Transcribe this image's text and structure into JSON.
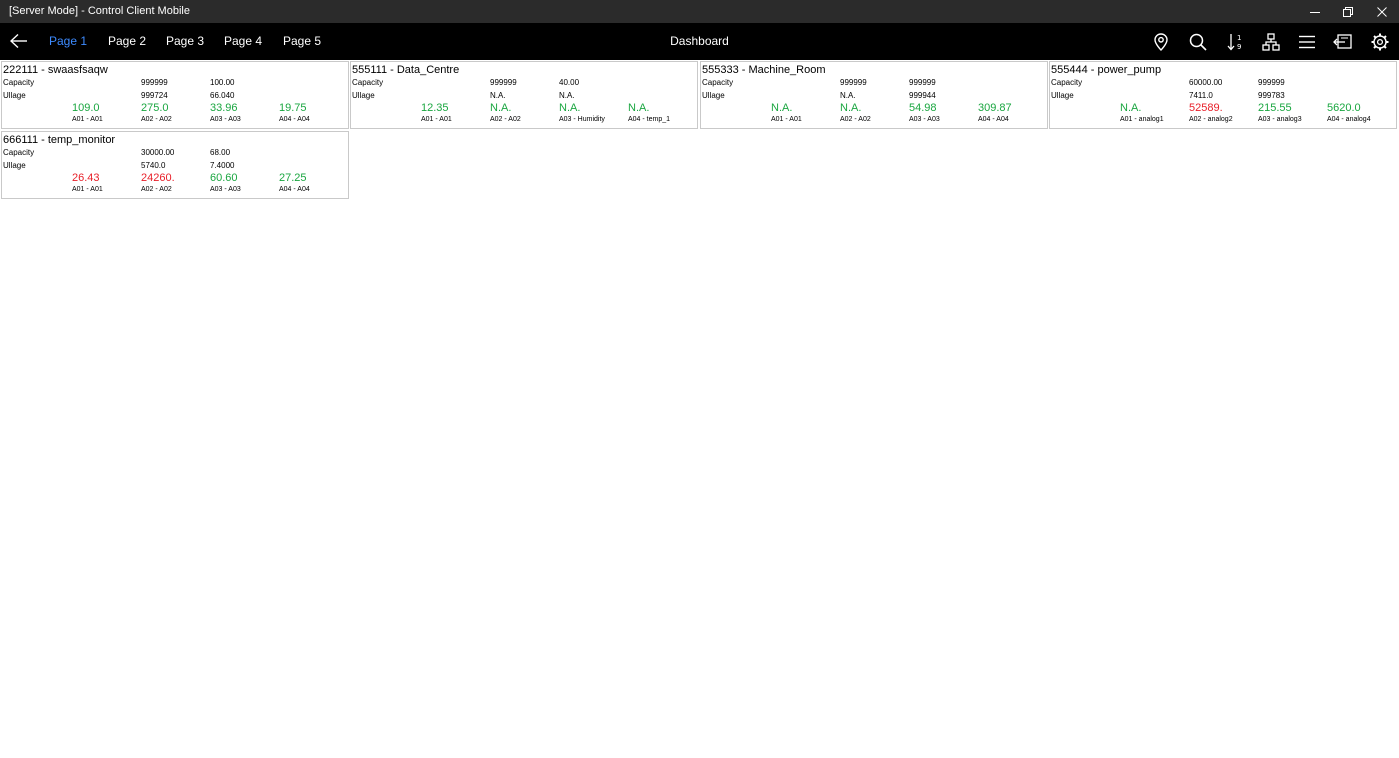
{
  "window": {
    "title": "[Server Mode] - Control Client Mobile",
    "controls": {
      "minimize": "—",
      "restore": "❐",
      "close": "✕"
    }
  },
  "appbar": {
    "title": "Dashboard",
    "tabs": [
      {
        "label": "Page 1",
        "active": true
      },
      {
        "label": "Page 2",
        "active": false
      },
      {
        "label": "Page 3",
        "active": false
      },
      {
        "label": "Page 4",
        "active": false
      },
      {
        "label": "Page 5",
        "active": false
      }
    ],
    "tools": [
      "location-icon",
      "search-icon",
      "sort-icon",
      "hierarchy-icon",
      "menu-icon",
      "export-icon",
      "settings-icon"
    ]
  },
  "colors": {
    "accent": "#3d8bff",
    "good": "#1aa640",
    "alarm": "#e8202a"
  },
  "cards": [
    {
      "name": "222111 - swaasfsaqw",
      "capacity_label": "Capacity",
      "ullage_label": "Ullage",
      "capacity": [
        "999999",
        "100.00"
      ],
      "ullage": [
        "999724",
        "66.040"
      ],
      "readings": [
        {
          "value": "109.0",
          "label": "A01 - A01",
          "status": "green"
        },
        {
          "value": "275.0",
          "label": "A02 - A02",
          "status": "green"
        },
        {
          "value": "33.96",
          "label": "A03 - A03",
          "status": "green"
        },
        {
          "value": "19.75",
          "label": "A04 - A04",
          "status": "green"
        }
      ]
    },
    {
      "name": "555111 - Data_Centre",
      "capacity_label": "Capacity",
      "ullage_label": "Ullage",
      "capacity": [
        "999999",
        "40.00"
      ],
      "ullage": [
        "N.A.",
        "N.A."
      ],
      "readings": [
        {
          "value": "12.35",
          "label": "A01 - A01",
          "status": "green"
        },
        {
          "value": "N.A.",
          "label": "A02 - A02",
          "status": "green"
        },
        {
          "value": "N.A.",
          "label": "A03 - Humidity",
          "status": "green"
        },
        {
          "value": "N.A.",
          "label": "A04 - temp_1",
          "status": "green"
        }
      ]
    },
    {
      "name": "555333 - Machine_Room",
      "capacity_label": "Capacity",
      "ullage_label": "Ullage",
      "capacity": [
        "999999",
        "999999"
      ],
      "ullage": [
        "N.A.",
        "999944"
      ],
      "readings": [
        {
          "value": "N.A.",
          "label": "A01 - A01",
          "status": "green"
        },
        {
          "value": "N.A.",
          "label": "A02 - A02",
          "status": "green"
        },
        {
          "value": "54.98",
          "label": "A03 - A03",
          "status": "green"
        },
        {
          "value": "309.87",
          "label": "A04 - A04",
          "status": "green"
        }
      ]
    },
    {
      "name": "555444 - power_pump",
      "capacity_label": "Capacity",
      "ullage_label": "Ullage",
      "capacity": [
        "60000.00",
        "999999"
      ],
      "ullage": [
        "7411.0",
        "999783"
      ],
      "readings": [
        {
          "value": "N.A.",
          "label": "A01 - analog1",
          "status": "green"
        },
        {
          "value": "52589.",
          "label": "A02 - analog2",
          "status": "red"
        },
        {
          "value": "215.55",
          "label": "A03 - analog3",
          "status": "green"
        },
        {
          "value": "5620.0",
          "label": "A04 - analog4",
          "status": "green"
        }
      ]
    },
    {
      "name": "666111 - temp_monitor",
      "capacity_label": "Capacity",
      "ullage_label": "Ullage",
      "capacity": [
        "30000.00",
        "68.00"
      ],
      "ullage": [
        "5740.0",
        "7.4000"
      ],
      "readings": [
        {
          "value": "26.43",
          "label": "A01 - A01",
          "status": "red"
        },
        {
          "value": "24260.",
          "label": "A02 - A02",
          "status": "red"
        },
        {
          "value": "60.60",
          "label": "A03 - A03",
          "status": "green"
        },
        {
          "value": "27.25",
          "label": "A04 - A04",
          "status": "green"
        }
      ]
    }
  ]
}
